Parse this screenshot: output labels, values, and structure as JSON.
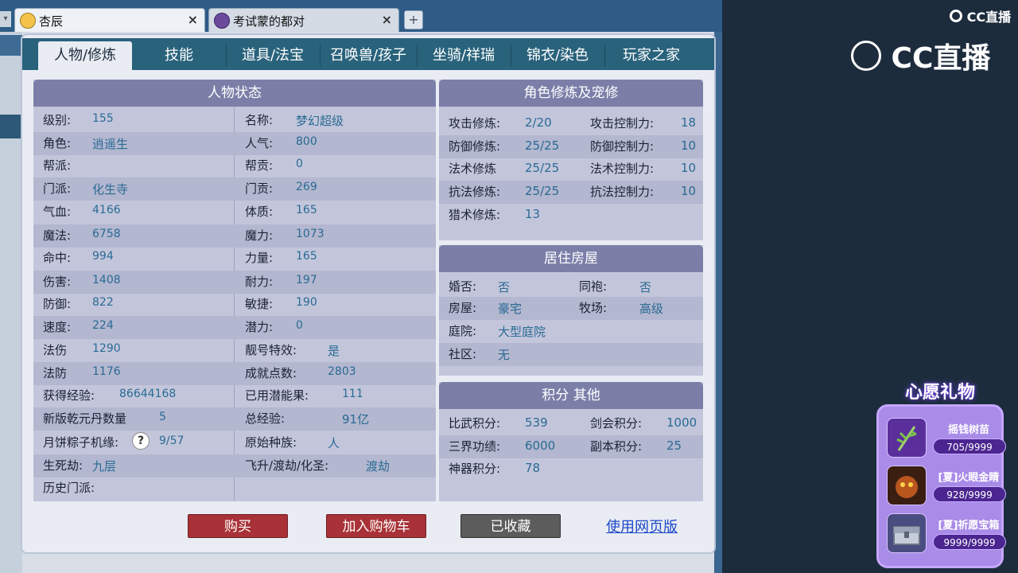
{
  "browser": {
    "tabs": [
      {
        "title": "杏辰",
        "active": true
      },
      {
        "title": "考试蒙的都对",
        "active": false
      }
    ],
    "new_tab": "+",
    "close": "×"
  },
  "nav": {
    "tabs": [
      "人物/修炼",
      "技能",
      "道具/法宝",
      "召唤兽/孩子",
      "坐骑/祥瑞",
      "锦衣/染色",
      "玩家之家"
    ],
    "active_index": 0
  },
  "status": {
    "title": "人物状态",
    "left": [
      {
        "label": "级别:",
        "value": "155"
      },
      {
        "label": "角色:",
        "value": "逍遥生"
      },
      {
        "label": "帮派:",
        "value": ""
      },
      {
        "label": "门派:",
        "value": "化生寺"
      },
      {
        "label": "气血:",
        "value": "4166"
      },
      {
        "label": "魔法:",
        "value": "6758"
      },
      {
        "label": "命中:",
        "value": "994"
      },
      {
        "label": "伤害:",
        "value": "1408"
      },
      {
        "label": "防御:",
        "value": "822"
      },
      {
        "label": "速度:",
        "value": "224"
      },
      {
        "label": "法伤",
        "value": "1290"
      },
      {
        "label": "法防",
        "value": "1176"
      },
      {
        "label": "获得经验:",
        "value": "86644168"
      },
      {
        "label": "新版乾元丹数量",
        "value": "5"
      },
      {
        "label": "月饼粽子机缘:",
        "value": "9/57"
      },
      {
        "label": "生死劫:",
        "value": "九层"
      },
      {
        "label": "历史门派:",
        "value": ""
      }
    ],
    "right": [
      {
        "label": "名称:",
        "value": "梦幻超级"
      },
      {
        "label": "人气:",
        "value": "800"
      },
      {
        "label": "帮贡:",
        "value": "0"
      },
      {
        "label": "门贡:",
        "value": "269"
      },
      {
        "label": "体质:",
        "value": "165"
      },
      {
        "label": "魔力:",
        "value": "1073"
      },
      {
        "label": "力量:",
        "value": "165"
      },
      {
        "label": "耐力:",
        "value": "197"
      },
      {
        "label": "敏捷:",
        "value": "190"
      },
      {
        "label": "潜力:",
        "value": "0"
      },
      {
        "label": "靓号特效:",
        "value": "是"
      },
      {
        "label": "成就点数:",
        "value": "2803"
      },
      {
        "label": "已用潜能果:",
        "value": "111"
      },
      {
        "label": "总经验:",
        "value": "91亿"
      },
      {
        "label": "原始种族:",
        "value": "人"
      },
      {
        "label": "飞升/渡劫/化圣:",
        "value": "渡劫"
      }
    ]
  },
  "cultivation": {
    "title": "角色修炼及宠修",
    "rows": [
      {
        "l1": "攻击修炼:",
        "v1": "2/20",
        "l2": "攻击控制力:",
        "v2": "18"
      },
      {
        "l1": "防御修炼:",
        "v1": "25/25",
        "l2": "防御控制力:",
        "v2": "10"
      },
      {
        "l1": "法术修炼",
        "v1": "25/25",
        "l2": "法术控制力:",
        "v2": "10"
      },
      {
        "l1": "抗法修炼:",
        "v1": "25/25",
        "l2": "抗法控制力:",
        "v2": "10"
      },
      {
        "l1": "猎术修炼:",
        "v1": "13",
        "l2": "",
        "v2": ""
      }
    ]
  },
  "housing": {
    "title": "居住房屋",
    "rows": [
      {
        "l1": "婚否:",
        "v1": "否",
        "l2": "同袍:",
        "v2": "否"
      },
      {
        "l1": "房屋:",
        "v1": "豪宅",
        "l2": "牧场:",
        "v2": "高级"
      },
      {
        "l1": "庭院:",
        "v1": "大型庭院",
        "l2": "",
        "v2": ""
      },
      {
        "l1": "社区:",
        "v1": "无",
        "l2": "",
        "v2": ""
      }
    ]
  },
  "points": {
    "title": "积分 其他",
    "rows": [
      {
        "l1": "比武积分:",
        "v1": "539",
        "l2": "剑会积分:",
        "v2": "1000"
      },
      {
        "l1": "三界功绩:",
        "v1": "6000",
        "l2": "副本积分:",
        "v2": "25"
      },
      {
        "l1": "神器积分:",
        "v1": "78",
        "l2": "",
        "v2": ""
      }
    ]
  },
  "actions": {
    "buy": "购买",
    "add_cart": "加入购物车",
    "favorited": "已收藏",
    "web_version": "使用网页版",
    "help": "?"
  },
  "overlay": {
    "cc_small": "CC直播",
    "cc_big": "CC直播",
    "wish_title": "心愿礼物",
    "gifts": [
      {
        "name": "摇钱树苗",
        "count": "705/9999"
      },
      {
        "name": "[夏]火眼金睛",
        "count": "928/9999"
      },
      {
        "name": "[夏]祈愿宝箱",
        "count": "9999/9999"
      }
    ]
  },
  "colors": {
    "nav_bar": "#29627b",
    "section_header": "#7b7fa8",
    "value_text": "#2a6a94",
    "button_red": "#a83237",
    "button_gray": "#5c5c5c",
    "link": "#1d49c9",
    "wish_panel": "#a98be8"
  }
}
